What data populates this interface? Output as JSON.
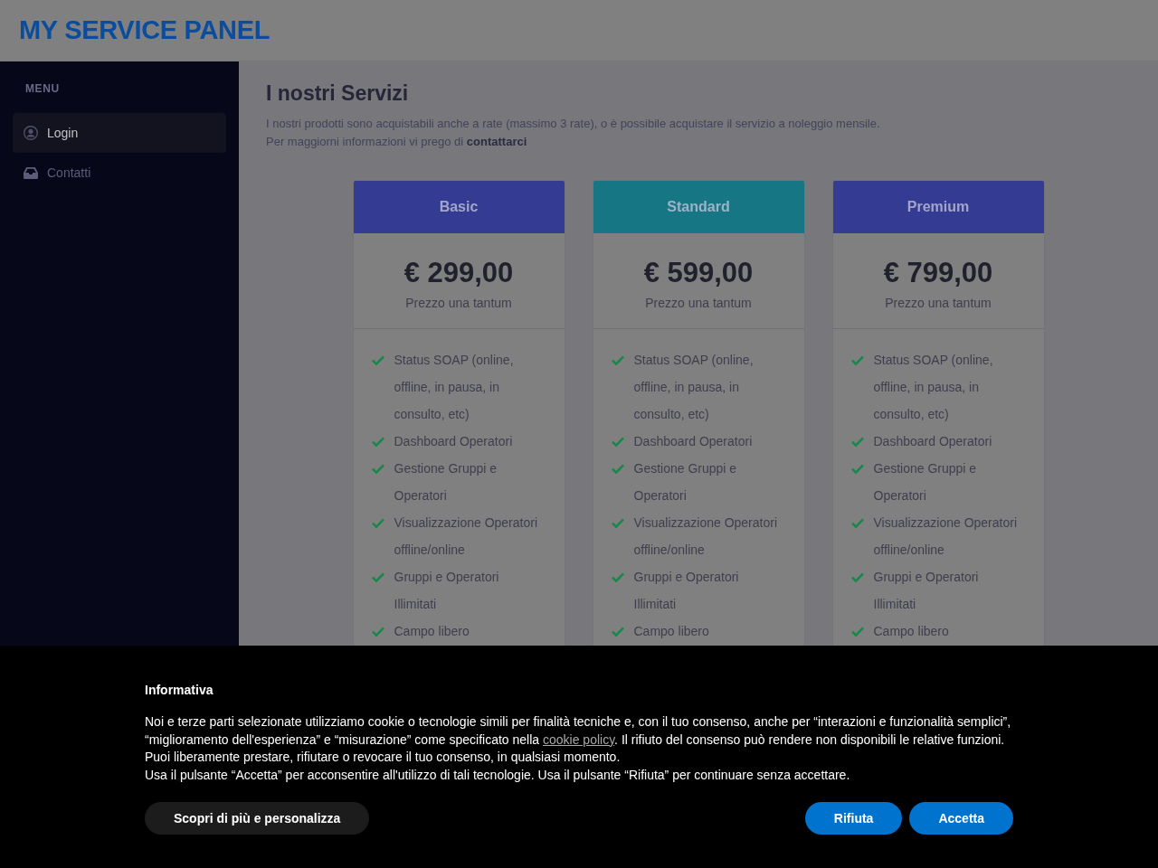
{
  "header": {
    "logo": "MY SERVICE PANEL"
  },
  "sidebar": {
    "heading": "MENU",
    "items": [
      {
        "label": "Login",
        "selected": true
      },
      {
        "label": "Contatti",
        "selected": false
      }
    ]
  },
  "main": {
    "title": "I nostri Servizi",
    "intro": [
      "I nostri prodotti sono acquistabili anche a rate (massimo 3 rate), o è possibile acquistare il servizio a noleggio mensile.",
      "Per maggiorni informazioni vi prego di **contattarci**"
    ]
  },
  "plans": [
    {
      "name": "Basic",
      "color": "#343b92",
      "price": "€ 299,00",
      "price_note": "Prezzo una tantum",
      "features": [
        "Status SOAP (online, offline, in pausa, in consulto, etc)",
        "Dashboard Operatori",
        "Gestione Gruppi e Operatori",
        "Visualizzazione Operatori offline/online",
        "Gruppi e Operatori Illimitati",
        "Campo libero"
      ]
    },
    {
      "name": "Standard",
      "color": "#177684",
      "price": "€ 599,00",
      "price_note": "Prezzo una tantum",
      "features": [
        "Status SOAP (online, offline, in pausa, in consulto, etc)",
        "Dashboard Operatori",
        "Gestione Gruppi e Operatori",
        "Visualizzazione Operatori offline/online",
        "Gruppi e Operatori Illimitati",
        "Campo libero"
      ]
    },
    {
      "name": "Premium",
      "color": "#343b92",
      "price": "€ 799,00",
      "price_note": "Prezzo una tantum",
      "features": [
        "Status SOAP (online, offline, in pausa, in consulto, etc)",
        "Dashboard Operatori",
        "Gestione Gruppi e Operatori",
        "Visualizzazione Operatori offline/online",
        "Gruppi e Operatori Illimitati",
        "Campo libero"
      ]
    }
  ],
  "cookie_banner": {
    "title": "Informativa",
    "paragraphs": [
      {
        "before": "Noi e terze parti selezionate utilizziamo cookie o tecnologie simili per finalità tecniche e, con il tuo consenso, anche per “interazioni e funzionalità semplici”, “miglioramento dell'esperienza” e “misurazione” come specificato nella ",
        "link": "cookie policy",
        "after": ". Il rifiuto del consenso può rendere non disponibili le relative funzioni. Puoi liberamente prestare, rifiutare o revocare il tuo consenso, in qualsiasi momento."
      },
      {
        "before": "Usa il pulsante “Accetta” per acconsentire all'utilizzo di tali tecnologie. Usa il pulsante “Rifiuta” per continuare senza accettare."
      }
    ],
    "buttons": [
      {
        "label": "Scopri di più e personalizza",
        "kind": "secondary"
      },
      {
        "label": "Rifiuta",
        "kind": "primary"
      },
      {
        "label": "Accetta",
        "kind": "primary"
      }
    ]
  }
}
